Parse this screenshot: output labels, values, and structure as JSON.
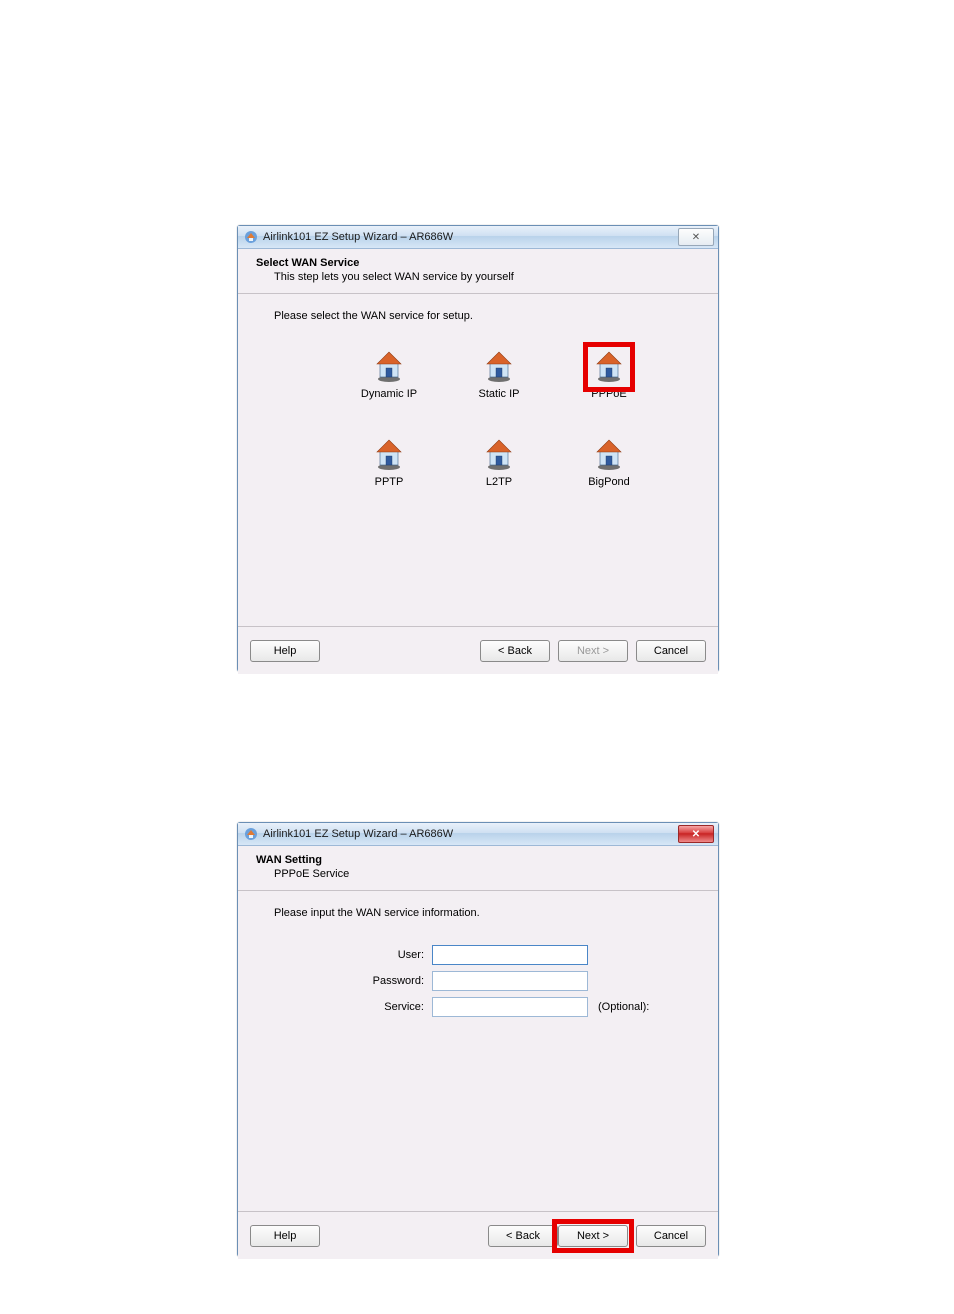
{
  "window1": {
    "title": "Airlink101 EZ Setup Wizard – AR686W",
    "close_glyph": "✕",
    "heading": "Select WAN Service",
    "subheading": "This step lets you select WAN service by yourself",
    "instruction": "Please select the WAN service for setup.",
    "options": {
      "dynamic_ip": "Dynamic IP",
      "static_ip": "Static IP",
      "pppoe": "PPPoE",
      "pptp": "PPTP",
      "l2tp": "L2TP",
      "bigpond": "BigPond"
    },
    "buttons": {
      "help": "Help",
      "back": "< Back",
      "next": "Next >",
      "cancel": "Cancel"
    }
  },
  "window2": {
    "title": "Airlink101 EZ Setup Wizard – AR686W",
    "close_glyph": "✕",
    "heading": "WAN Setting",
    "subheading": "PPPoE Service",
    "instruction": "Please input the WAN service information.",
    "fields": {
      "user_label": "User:",
      "user_value": "",
      "password_label": "Password:",
      "password_value": "",
      "service_label": "Service:",
      "service_value": "",
      "service_suffix": "(Optional):"
    },
    "buttons": {
      "help": "Help",
      "back": "< Back",
      "next": "Next >",
      "cancel": "Cancel"
    }
  }
}
